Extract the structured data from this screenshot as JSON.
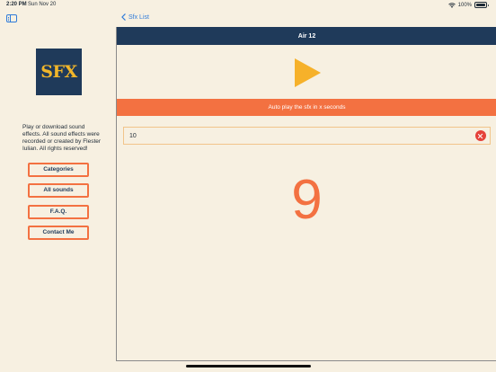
{
  "status_bar": {
    "time": "2:20 PM",
    "date": "Sun Nov 20",
    "battery": "100%"
  },
  "sidebar": {
    "logo_text": "SFX",
    "description": "Play or download sound effects. All sound effects were recorded or created by Flester Iulian. All rights reserved!",
    "buttons": [
      {
        "label": "Categories"
      },
      {
        "label": "All sounds"
      },
      {
        "label": "F.A.Q."
      },
      {
        "label": "Contact Me"
      }
    ]
  },
  "nav": {
    "back_label": "Sfx List"
  },
  "detail": {
    "title": "Air 12",
    "autoplay_text": "Auto play the sfx in x seconds",
    "seconds_value": "10",
    "countdown": "9"
  },
  "colors": {
    "navy": "#1f3a5a",
    "orange": "#f37141",
    "play_yellow": "#f6b12a",
    "background": "#f7f0e1",
    "link_blue": "#2f7bd9",
    "clear_red": "#e5413a"
  },
  "icons": {
    "sidebar_toggle": "sidebar-icon",
    "back": "chevron-left-icon",
    "play": "play-icon",
    "clear": "clear-circle-icon"
  }
}
